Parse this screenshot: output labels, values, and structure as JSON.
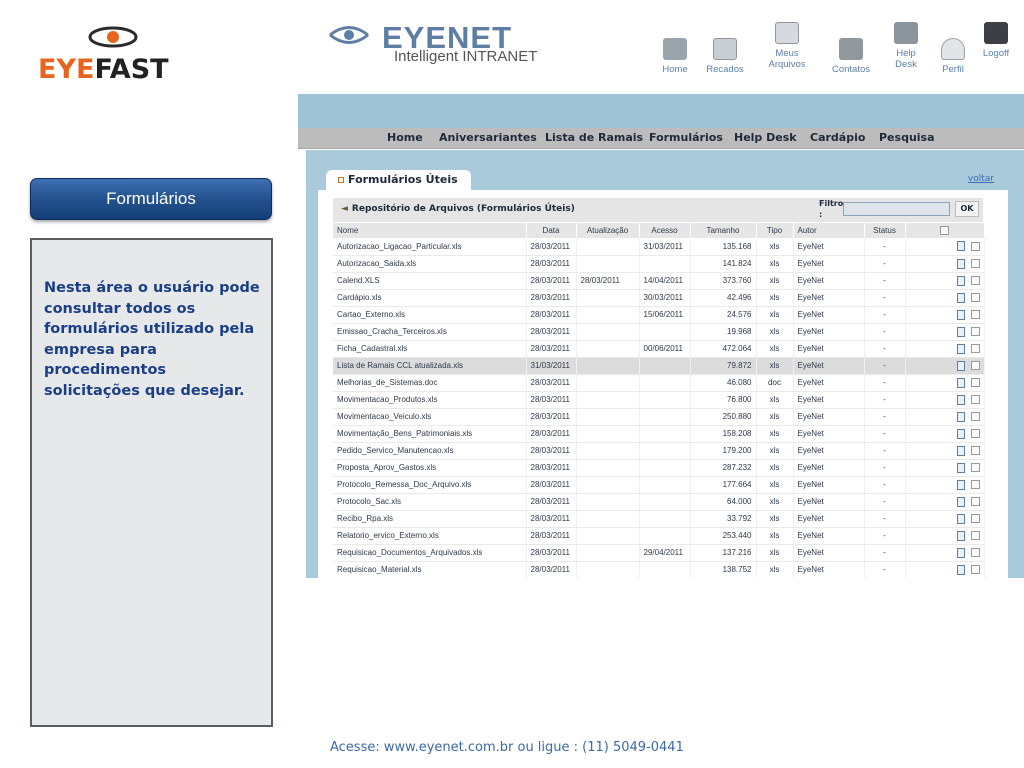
{
  "logo": {
    "part1": "EYE",
    "part2": "FAST"
  },
  "sidebar": {
    "button_label": "Formulários",
    "description": "Nesta área o usuário pode consultar todos os formulários utilizado pela empresa para procedimentos solicitações que desejar."
  },
  "footer": {
    "text": "Acesse: www.eyenet.com.br ou ligue : (11) 5049-0441"
  },
  "app": {
    "brand": "EYENET",
    "tagline": "Intelligent INTRANET",
    "top_nav": [
      {
        "label": "Home",
        "icon": "home-icon"
      },
      {
        "label": "Recados",
        "icon": "notepad-icon"
      },
      {
        "label": "Meus Arquivos",
        "icon": "folder-icon"
      },
      {
        "label": "Contatos",
        "icon": "contacts-icon"
      },
      {
        "label": "Help Desk",
        "icon": "monitor-icon"
      },
      {
        "label": "Perfil",
        "icon": "user-icon"
      },
      {
        "label": "Logoff",
        "icon": "lock-icon"
      }
    ],
    "menu": [
      "Home",
      "Aniversariantes",
      "Lista de Ramais",
      "Formulários",
      "Help Desk",
      "Cardápio",
      "Pesquisa"
    ],
    "tab_title": "Formulários Úteis",
    "back_link": "voltar",
    "repo_title": "Repositório de Arquivos (Formulários Úteis)",
    "filter_label": "Filtro :",
    "filter_value": "",
    "ok_label": "OK",
    "columns": [
      "Nome",
      "Data",
      "Atualização",
      "Acesso",
      "Tamanho",
      "Tipo",
      "Autor",
      "Status"
    ],
    "rows": [
      [
        "Autorizacao_Ligacao_Particular.xls",
        "28/03/2011",
        "",
        "31/03/2011",
        "135.168",
        "xls",
        "EyeNet",
        "-"
      ],
      [
        "Autorizacao_Saida.xls",
        "28/03/2011",
        "",
        "",
        "141.824",
        "xls",
        "EyeNet",
        "-"
      ],
      [
        "Calend.XLS",
        "28/03/2011",
        "28/03/2011",
        "14/04/2011",
        "373.760",
        "xls",
        "EyeNet",
        "-"
      ],
      [
        "Cardápio.xls",
        "28/03/2011",
        "",
        "30/03/2011",
        "42.496",
        "xls",
        "EyeNet",
        "-"
      ],
      [
        "Cartao_Externo.xls",
        "28/03/2011",
        "",
        "15/06/2011",
        "24.576",
        "xls",
        "EyeNet",
        "-"
      ],
      [
        "Emissao_Cracha_Terceiros.xls",
        "28/03/2011",
        "",
        "",
        "19.968",
        "xls",
        "EyeNet",
        "-"
      ],
      [
        "Ficha_Cadastral.xls",
        "28/03/2011",
        "",
        "00/06/2011",
        "472.064",
        "xls",
        "EyeNet",
        "-"
      ],
      [
        "Lista de Ramais CCL atualizada.xls",
        "31/03/2011",
        "",
        "",
        "79.872",
        "xls",
        "EyeNet",
        "-"
      ],
      [
        "Melhorias_de_Sistemas.doc",
        "28/03/2011",
        "",
        "",
        "46.080",
        "doc",
        "EyeNet",
        "-"
      ],
      [
        "Movimentacao_Produtos.xls",
        "28/03/2011",
        "",
        "",
        "76.800",
        "xls",
        "EyeNet",
        "-"
      ],
      [
        "Movimentacao_Veiculo.xls",
        "28/03/2011",
        "",
        "",
        "250.880",
        "xls",
        "EyeNet",
        "-"
      ],
      [
        "Movimentação_Bens_Patrimoniais.xls",
        "28/03/2011",
        "",
        "",
        "158.208",
        "xls",
        "EyeNet",
        "-"
      ],
      [
        "Pedido_Servico_Manutencao.xls",
        "28/03/2011",
        "",
        "",
        "179.200",
        "xls",
        "EyeNet",
        "-"
      ],
      [
        "Proposta_Aprov_Gastos.xls",
        "28/03/2011",
        "",
        "",
        "287.232",
        "xls",
        "EyeNet",
        "-"
      ],
      [
        "Protocolo_Remessa_Doc_Arquivo.xls",
        "28/03/2011",
        "",
        "",
        "177.664",
        "xls",
        "EyeNet",
        "-"
      ],
      [
        "Protocolo_Sac.xls",
        "28/03/2011",
        "",
        "",
        "64.000",
        "xls",
        "EyeNet",
        "-"
      ],
      [
        "Recibo_Rpa.xls",
        "28/03/2011",
        "",
        "",
        "33.792",
        "xls",
        "EyeNet",
        "-"
      ],
      [
        "Relatorio_ervico_Externo.xls",
        "28/03/2011",
        "",
        "",
        "253.440",
        "xls",
        "EyeNet",
        "-"
      ],
      [
        "Requisicao_Documentos_Arquivados.xls",
        "28/03/2011",
        "",
        "29/04/2011",
        "137.216",
        "xls",
        "EyeNet",
        "-"
      ],
      [
        "Requisicao_Material.xls",
        "28/03/2011",
        "",
        "",
        "138.752",
        "xls",
        "EyeNet",
        "-"
      ]
    ],
    "selected_row": 7
  },
  "colors": {
    "accent_orange": "#e8641e",
    "button_blue": "#24528f",
    "band_blue": "#9ec3d6",
    "text_blue": "#1a3f87"
  }
}
